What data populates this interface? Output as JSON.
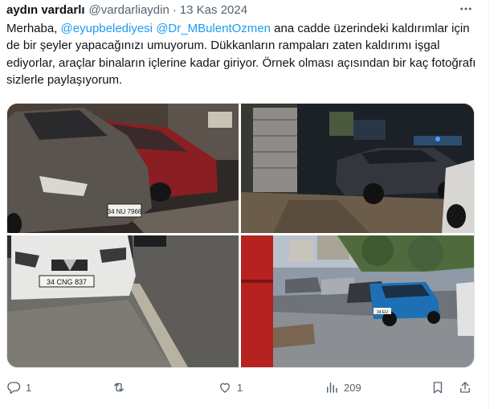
{
  "tweet": {
    "author_name": "aydın vardarlı",
    "handle": "@vardarliaydin",
    "separator": "·",
    "date": "13 Kas 2024",
    "text_intro": "Merhaba, ",
    "mention_1": "@eyupbelediyesi",
    "mention_2": "@Dr_MBulentOzmen",
    "text_body": "  ana cadde üzerindeki kaldırımlar için de bir şeyler yapacağınızı umuyorum. Dükkanların rampaları zaten kaldırımı işgal ediyorlar, araçlar binaların içlerine kadar giriyor. Örnek olması açısından bir kaç fotoğrafı sizlerle paylaşıyorum."
  },
  "media": {
    "photo_1_plate": "34 NU 7966",
    "photo_3_plate": "34 CNG 837",
    "photo_4_plate": "34 EU"
  },
  "actions": {
    "reply_count": "1",
    "retweet_count": "",
    "like_count": "1",
    "view_count": "209"
  },
  "icons": [
    "more-icon",
    "reply-icon",
    "retweet-icon",
    "like-icon",
    "views-icon",
    "bookmark-icon",
    "share-icon"
  ],
  "colors": {
    "link": "#1d9bf0",
    "secondary_text": "#536471",
    "primary_text": "#0f1419"
  }
}
